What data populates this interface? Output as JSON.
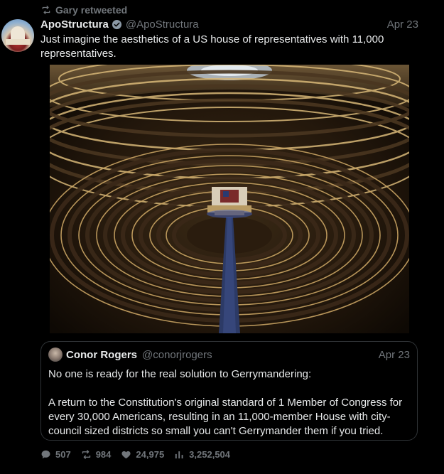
{
  "retweet": {
    "text": "Gary retweeted",
    "icon": "retweet-icon"
  },
  "tweet": {
    "author_name": "ApoStructura",
    "handle": "@ApoStructura",
    "date": "Apr 23",
    "text": "Just imagine the aesthetics of a US house of representatives with 11,000 representatives.",
    "verified_color": "#8b98a5",
    "media_description_icon": "image"
  },
  "quote": {
    "author_name": "Conor Rogers",
    "handle": "@conorjrogers",
    "date": "Apr 23",
    "paragraph1": "No one is ready for the real solution to Gerrymandering:",
    "paragraph2": "A return to the Constitution's original standard of 1 Member of Congress for every 30,000 Americans, resulting in an 11,000-member House with city-council sized districts so small you can't Gerrymander them if you tried."
  },
  "actions": {
    "replies": "507",
    "retweets": "984",
    "likes": "24,975",
    "views": "3,252,504"
  },
  "colors": {
    "background": "#000000",
    "text": "#e7e9ea",
    "muted": "#71767b",
    "border": "#2f3336"
  }
}
